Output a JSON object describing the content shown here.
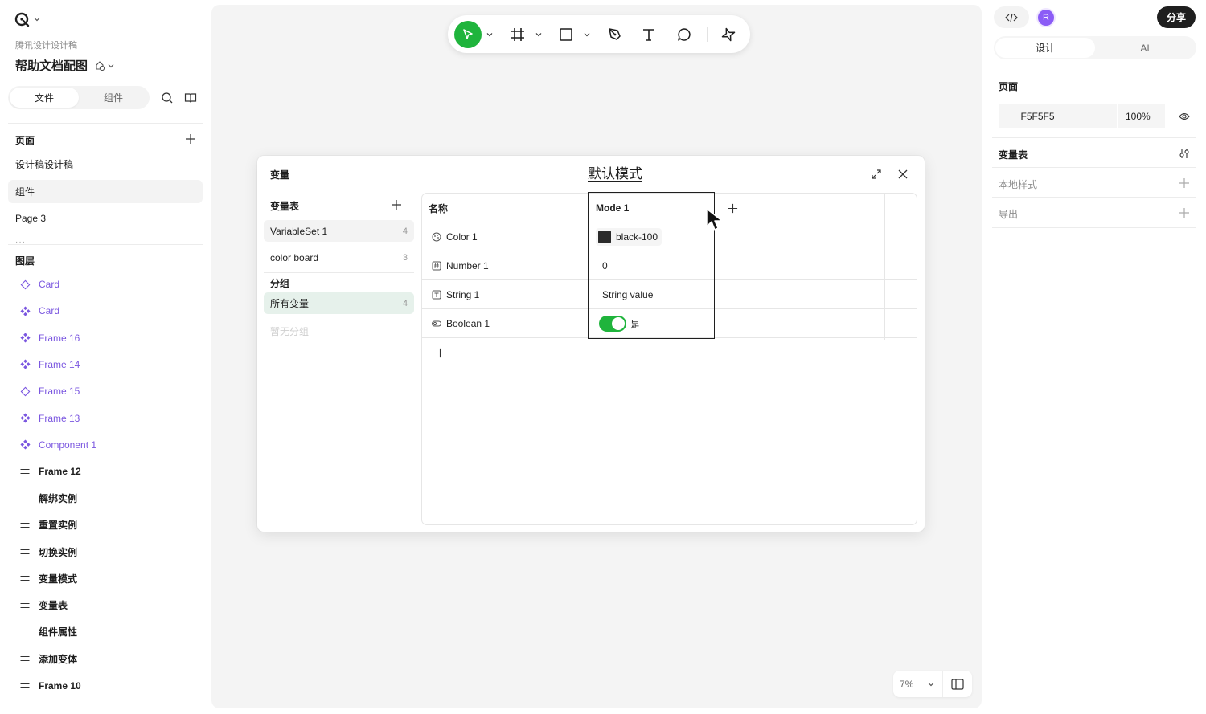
{
  "left": {
    "team": "腾讯设计设计稿",
    "file_title": "帮助文档配图",
    "tabs": [
      "文件",
      "组件"
    ],
    "pages_title": "页面",
    "pages": [
      "设计稿设计稿",
      "组件",
      "Page 3"
    ],
    "pages_more": "···",
    "layers_title": "图层",
    "layers": [
      {
        "name": "Card",
        "icon": "component-outline-icon",
        "style": "purple"
      },
      {
        "name": "Card",
        "icon": "component-icon",
        "style": "purple"
      },
      {
        "name": "Frame 16",
        "icon": "component-icon",
        "style": "purple"
      },
      {
        "name": "Frame 14",
        "icon": "component-icon",
        "style": "purple"
      },
      {
        "name": "Frame 15",
        "icon": "component-outline-icon",
        "style": "purple"
      },
      {
        "name": "Frame 13",
        "icon": "component-icon",
        "style": "purple"
      },
      {
        "name": "Component 1",
        "icon": "component-icon",
        "style": "purple"
      },
      {
        "name": "Frame 12",
        "icon": "frame-icon",
        "style": "dark"
      },
      {
        "name": "解绑实例",
        "icon": "frame-icon",
        "style": "dark"
      },
      {
        "name": "重置实例",
        "icon": "frame-icon",
        "style": "dark"
      },
      {
        "name": "切换实例",
        "icon": "frame-icon",
        "style": "dark"
      },
      {
        "name": "变量模式",
        "icon": "frame-icon",
        "style": "dark"
      },
      {
        "name": "变量表",
        "icon": "frame-icon",
        "style": "dark"
      },
      {
        "name": "组件属性",
        "icon": "frame-icon",
        "style": "dark"
      },
      {
        "name": "添加变体",
        "icon": "frame-icon",
        "style": "dark"
      },
      {
        "name": "Frame 10",
        "icon": "frame-icon",
        "style": "dark"
      }
    ]
  },
  "toolbar": {
    "tools": [
      "move-tool-icon",
      "frame-tool-icon",
      "rectangle-tool-icon",
      "pen-tool-icon",
      "text-tool-icon",
      "comment-tool-icon",
      "ai-tool-icon"
    ],
    "accent": "#1fb43c"
  },
  "zoom": {
    "value": "7%"
  },
  "variables": {
    "title": "变量",
    "mode_title": "默认模式",
    "sets_title": "变量表",
    "sets": [
      {
        "name": "VariableSet 1",
        "count": "4"
      },
      {
        "name": "color board",
        "count": "3"
      }
    ],
    "groups_title": "分组",
    "groups": [
      {
        "name": "所有变量",
        "count": "4"
      }
    ],
    "groups_empty": "暂无分组",
    "table": {
      "col_name": "名称",
      "col_mode": "Mode 1",
      "rows": [
        {
          "icon": "color-variable-icon",
          "name": "Color 1",
          "type": "color",
          "value": "black-100",
          "swatch": "#2a2a2a"
        },
        {
          "icon": "number-variable-icon",
          "name": "Number 1",
          "type": "number",
          "value": "0"
        },
        {
          "icon": "string-variable-icon",
          "name": "String 1",
          "type": "string",
          "value": "String value"
        },
        {
          "icon": "boolean-variable-icon",
          "name": "Boolean 1",
          "type": "boolean",
          "value": "是"
        }
      ]
    }
  },
  "right": {
    "avatar": "R",
    "share": "分享",
    "tabs": [
      "设计",
      "AI"
    ],
    "page_title": "页面",
    "page_color": "F5F5F5",
    "page_opacity": "100%",
    "variables_title": "变量表",
    "local_styles": "本地样式",
    "export": "导出"
  }
}
